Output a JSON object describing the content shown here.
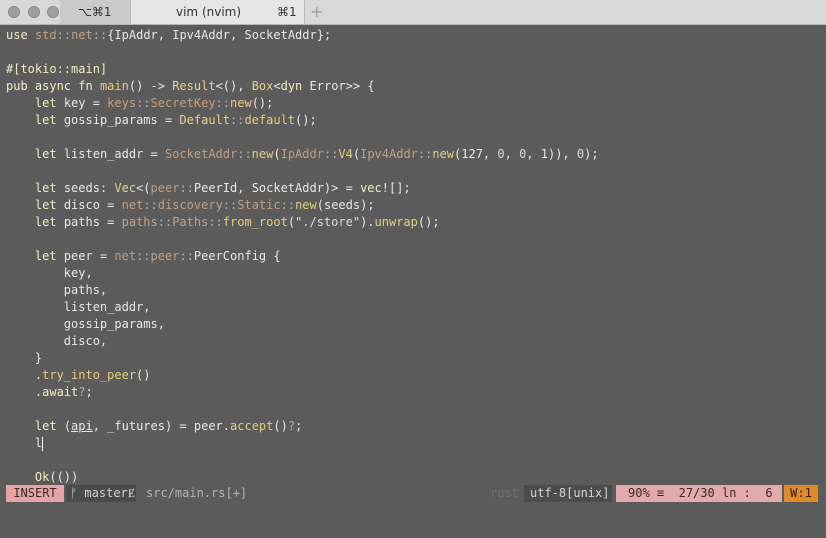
{
  "tabs": [
    {
      "label": "⌥⌘1",
      "active": false
    },
    {
      "label": "vim (nvim)",
      "shortcut": "⌘1",
      "active": true
    }
  ],
  "new_tab": "+",
  "code_lines": [
    "use std::net::{IpAddr, Ipv4Addr, SocketAddr};",
    "",
    "#[tokio::main]",
    "pub async fn main() -> Result<(), Box<dyn Error>> {",
    "    let key = keys::SecretKey::new();",
    "    let gossip_params = Default::default();",
    "",
    "    let listen_addr = SocketAddr::new(IpAddr::V4(Ipv4Addr::new(127, 0, 0, 1)), 0);",
    "",
    "    let seeds: Vec<(peer::PeerId, SocketAddr)> = vec![];",
    "    let disco = net::discovery::Static::new(seeds);",
    "    let paths = paths::Paths::from_root(\"./store\").unwrap();",
    "",
    "    let peer = net::peer::PeerConfig {",
    "        key,",
    "        paths,",
    "        listen_addr,",
    "        gossip_params,",
    "        disco,",
    "    }",
    "    .try_into_peer()",
    "    .await?;",
    "",
    "    let (api, _futures) = peer.accept()?;",
    "    l",
    "",
    "    Ok(())"
  ],
  "statusline": {
    "mode": "INSERT",
    "branch": "ᚠ master",
    "branch_mark": "Ɇ",
    "file": "src/main.rs[+]",
    "filetype": "rust",
    "encoding": "utf-8[unix]",
    "percent": "90%",
    "percent_icon": "≡",
    "line_pos": "27/30",
    "ln_label": "ln",
    "col_sep": ":",
    "col": "6",
    "warning": "W:1"
  },
  "colors": {
    "background": "#5b5b5b",
    "insert_mode": "#e5a5a5",
    "warning": "#e08a2a"
  }
}
